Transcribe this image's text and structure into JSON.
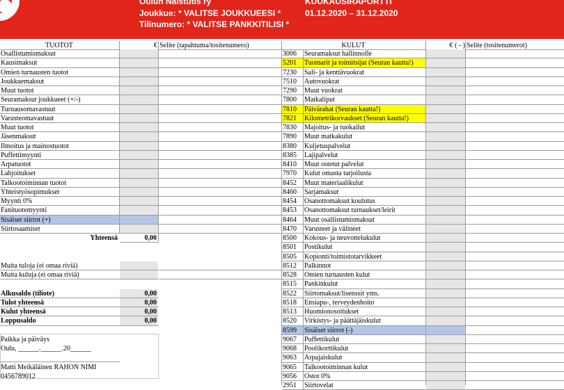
{
  "header": {
    "org": "Oulun Nälstutis ry",
    "team": "Joukkue: * VALITSE JOUKKUEESI *",
    "account": "Tilinumero: * VALITSE PANKKITILISI *",
    "report_title": "KUUKAUSIRAPORTTI",
    "period": "01.12.2020 – 31.12.2020"
  },
  "income": {
    "header": {
      "title": "TUOTOT",
      "euro": "€",
      "note": "Selite (tapahtuma/tositenumero)"
    },
    "rows": [
      "Osallistumismaksut",
      "Kausimaksut",
      "Omien turnausten tuotot",
      "Joukkuemaksut",
      "Muut tuotot",
      "Seuramaksut joukkueet (+/-)",
      "Turnausomavastuut",
      "Varusteomavastuut",
      "Muut tuotot",
      "Jäsenmaksut",
      "Ilmoitus ja mainostuotot",
      "Puffettimyynti",
      "Arpatuotot",
      "Lahjoitukset",
      "Talkootoiminnan tuotot",
      "Yhteistyösopimukset",
      "Myynti 0%",
      "Fanituotemyynti",
      "Sisäiset siirrot  (+)",
      "Siirtosaamiset"
    ],
    "total_label": "Yhteensä",
    "total_value": "0,00",
    "other": [
      "Muita tuloja (ei omaa riviä)",
      "Muita kuluja (ei omaa riviä)"
    ]
  },
  "balances": [
    {
      "label": "Alkusaldo (tiliote)",
      "value": "0,00"
    },
    {
      "label": "Tulot yhteensä",
      "value": "0,00"
    },
    {
      "label": "Kulut yhteensä",
      "value": "0,00"
    },
    {
      "label": "Loppusaldo",
      "value": "0,00"
    }
  ],
  "signature": {
    "place_label": "Paikka ja päiväys",
    "place_value": "Oulu, ______.______.20______",
    "name": "Matti Meikäläinen  RAHON NIMI",
    "phone": "0456789012"
  },
  "expenses": {
    "header": {
      "title": "KULUT",
      "euro": "€ ( - )",
      "note": "Selite (tositenumerot)"
    },
    "rows": [
      {
        "code": "3006",
        "label": "Seuramaksut hallinnolle",
        "hl": ""
      },
      {
        "code": "5201",
        "label": "Tuomarit ja toimitsijat (Seuran kautta!)",
        "hl": "yellow"
      },
      {
        "code": "7230",
        "label": "Sali- ja kenttävuokrat",
        "hl": ""
      },
      {
        "code": "7510",
        "label": "Autovuokrat",
        "hl": ""
      },
      {
        "code": "7290",
        "label": "Muut vuokrat",
        "hl": ""
      },
      {
        "code": "7800",
        "label": "Matkaliput",
        "hl": ""
      },
      {
        "code": "7810",
        "label": "Päivärahat (Seuran kautta!)",
        "hl": "yellow"
      },
      {
        "code": "7821",
        "label": "Kilometrikorvaukset (Seuran kautta!)",
        "hl": "yellow"
      },
      {
        "code": "7830",
        "label": "Majoitus- ja ruokailut",
        "hl": ""
      },
      {
        "code": "7890",
        "label": "Muut matkakulut",
        "hl": ""
      },
      {
        "code": "8380",
        "label": "Kuljetuspalvelut",
        "hl": ""
      },
      {
        "code": "8385",
        "label": "Lajipalvelut",
        "hl": ""
      },
      {
        "code": "8410",
        "label": "Muut ostetut palvelut",
        "hl": ""
      },
      {
        "code": "7970",
        "label": "Kulut omasta tarjoilusta",
        "hl": ""
      },
      {
        "code": "8452",
        "label": "Muut materiaalikulut",
        "hl": ""
      },
      {
        "code": "8460",
        "label": "Sarjamaksut",
        "hl": ""
      },
      {
        "code": "8454",
        "label": "Osanottomaksut koulutus",
        "hl": ""
      },
      {
        "code": "8453",
        "label": "Osanottomaksut turnaukset/leirit",
        "hl": ""
      },
      {
        "code": "8464",
        "label": "Muut osallistumismaksut",
        "hl": ""
      },
      {
        "code": "8470",
        "label": "Varusteet ja välineet",
        "hl": ""
      },
      {
        "code": "8500",
        "label": "Kokous- ja neuvottelukulut",
        "hl": ""
      },
      {
        "code": "8501",
        "label": "Postikulut",
        "hl": ""
      },
      {
        "code": "8505",
        "label": "Kopionti/toimistotarvikkeet",
        "hl": ""
      },
      {
        "code": "8512",
        "label": "Palkinnot",
        "hl": ""
      },
      {
        "code": "8528",
        "label": "Omien turnausten kulut",
        "hl": ""
      },
      {
        "code": "8515",
        "label": "Pankinkulut",
        "hl": ""
      },
      {
        "code": "8522",
        "label": "Siirtomaksut/lisenssit yms.",
        "hl": ""
      },
      {
        "code": "8518",
        "label": "Ensiapu-, terveydenhoito",
        "hl": ""
      },
      {
        "code": "8513",
        "label": "Huomionosoitukset",
        "hl": ""
      },
      {
        "code": "8520",
        "label": "Virkistys- ja päättäjäiskulut",
        "hl": ""
      },
      {
        "code": "8599",
        "label": "Sisäiset siirrot  (-)",
        "hl": "blue"
      },
      {
        "code": "9067",
        "label": "Puffettikulut",
        "hl": ""
      },
      {
        "code": "9068",
        "label": "Poolikorttikulut",
        "hl": ""
      },
      {
        "code": "9063",
        "label": "Arpajaiskulut",
        "hl": ""
      },
      {
        "code": "9065",
        "label": "Talkootoiminnan kulut",
        "hl": ""
      },
      {
        "code": "9056",
        "label": "Ostot 0%",
        "hl": ""
      },
      {
        "code": "2951",
        "label": "Siirtovelat",
        "hl": ""
      }
    ]
  }
}
